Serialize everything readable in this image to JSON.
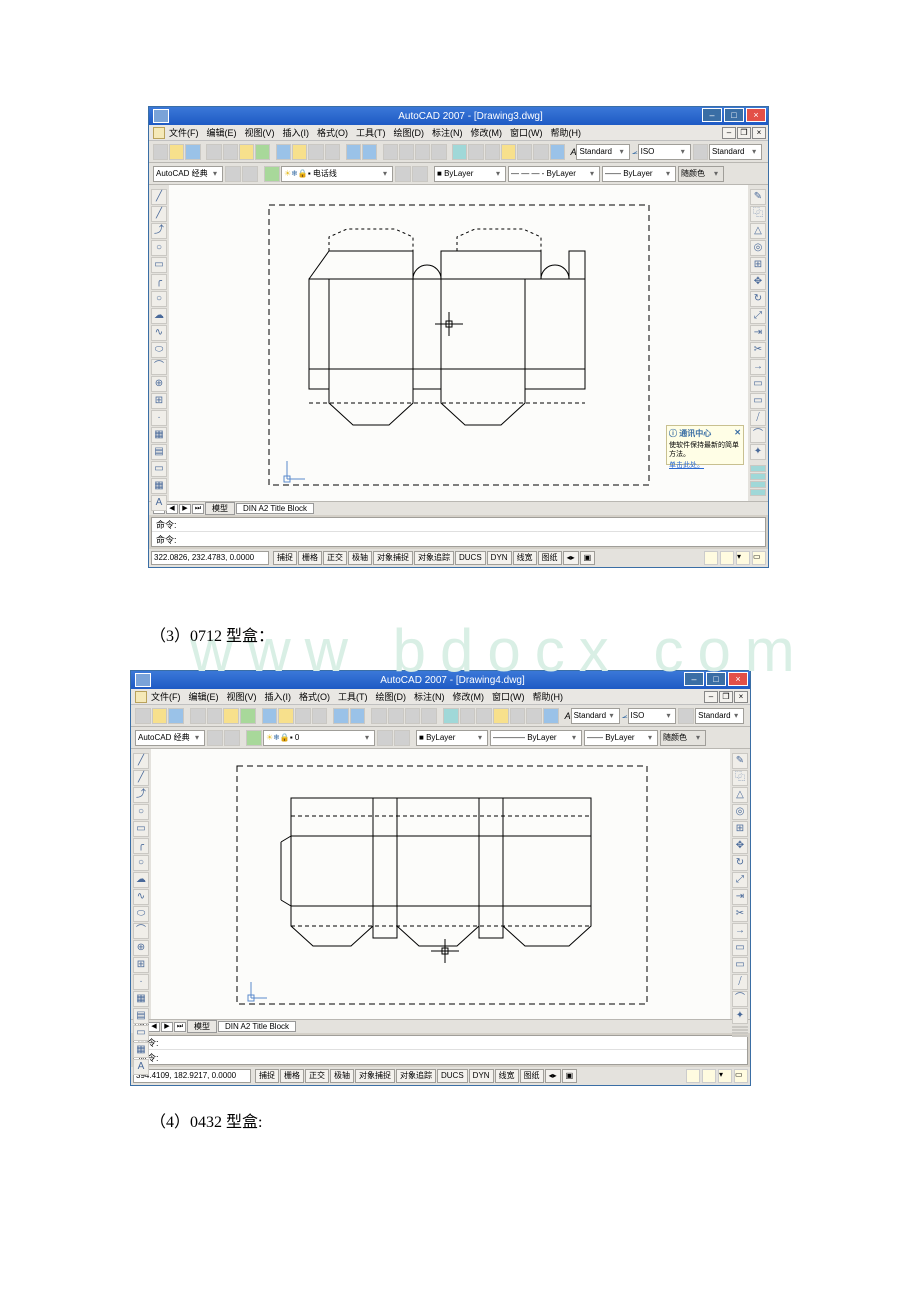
{
  "caption1": "（3）0712 型盒：",
  "caption2": "（4）0432 型盒:",
  "watermark": "www bdocx com",
  "win1": {
    "title": "AutoCAD 2007 - [Drawing3.dwg]",
    "menus": {
      "file": "文件(F)",
      "edit": "编辑(E)",
      "view": "视图(V)",
      "insert": "插入(I)",
      "format": "格式(O)",
      "tools": "工具(T)",
      "draw": "绘图(D)",
      "dimension": "标注(N)",
      "modify": "修改(M)",
      "window": "窗口(W)",
      "help": "帮助(H)"
    },
    "workspace": "AutoCAD 经典",
    "textstyle": "Standard",
    "dimstyle": "ISO",
    "tablestyle": "Standard",
    "layer": "电话线",
    "bylayer": "ByLayer",
    "linetype": "—  —  —  - ByLayer",
    "lineweight": "—— ByLayer",
    "plotstyle": "随颜色",
    "tab_model": "模型",
    "tab_title": "DIN A2 Title Block",
    "cmd": "命令:",
    "coords": "322.0826, 232.4783, 0.0000",
    "toggles": {
      "snap": "捕捉",
      "grid": "栅格",
      "ortho": "正交",
      "polar": "极轴",
      "osnap": "对象捕捉",
      "otrack": "对象追踪",
      "ducs": "DUCS",
      "dyn": "DYN",
      "lwt": "线宽",
      "model": "图纸"
    },
    "notif_title": "通讯中心",
    "notif_body": "使软件保持最新的简单方法。",
    "notif_link": "单击此处。"
  },
  "win2": {
    "title": "AutoCAD 2007 - [Drawing4.dwg]",
    "menus": {
      "file": "文件(F)",
      "edit": "编辑(E)",
      "view": "视图(V)",
      "insert": "插入(I)",
      "format": "格式(O)",
      "tools": "工具(T)",
      "draw": "绘图(D)",
      "dimension": "标注(N)",
      "modify": "修改(M)",
      "window": "窗口(W)",
      "help": "帮助(H)"
    },
    "workspace": "AutoCAD 经典",
    "textstyle": "Standard",
    "dimstyle": "ISO",
    "tablestyle": "Standard",
    "layer": "0",
    "bylayer": "ByLayer",
    "linetype": "———— ByLayer",
    "lineweight": "—— ByLayer",
    "plotstyle": "随颜色",
    "tab_model": "模型",
    "tab_title": "DIN A2 Title Block",
    "cmd": "命令:",
    "coords": "394.4109, 182.9217, 0.0000",
    "toggles": {
      "snap": "捕捉",
      "grid": "栅格",
      "ortho": "正交",
      "polar": "极轴",
      "osnap": "对象捕捉",
      "otrack": "对象追踪",
      "ducs": "DUCS",
      "dyn": "DYN",
      "lwt": "线宽",
      "model": "图纸"
    }
  }
}
